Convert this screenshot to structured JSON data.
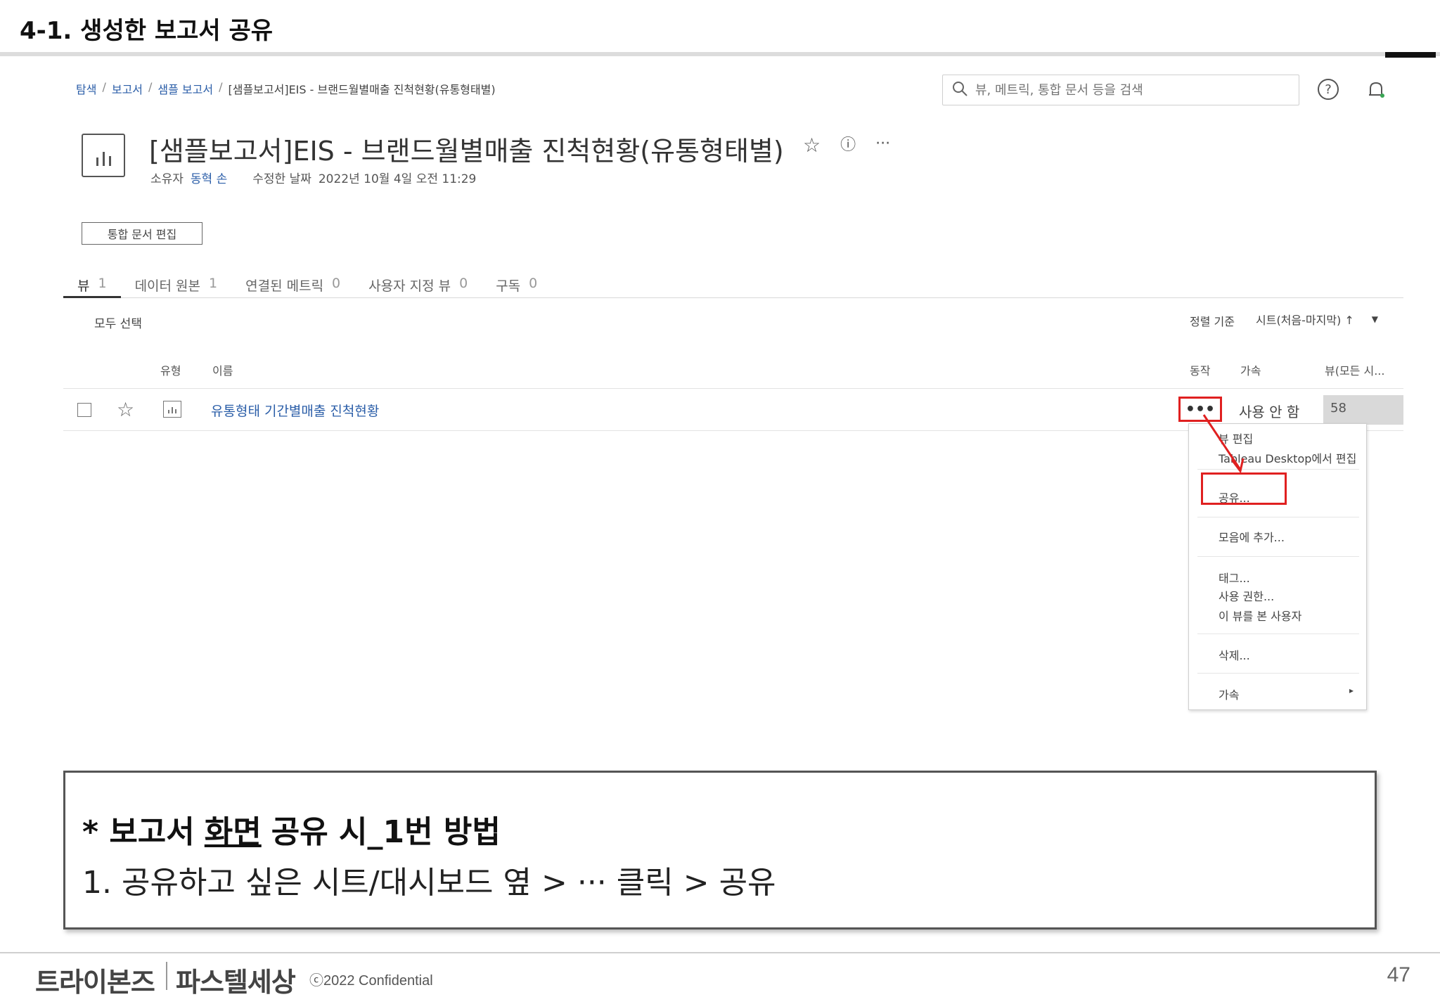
{
  "slide": {
    "title": "4-1. 생성한 보고서 공유",
    "page_number": "47",
    "copyright": "ⓒ2022 Confidential",
    "logo_left": "트라이본즈",
    "logo_right": "파스텔세상"
  },
  "breadcrumb": {
    "items": [
      "탐색",
      "보고서",
      "샘플 보고서",
      "[샘플보고서]EIS - 브랜드월별매출 진척현황(유통형태별)"
    ],
    "separator": "/"
  },
  "search": {
    "placeholder": "뷰, 메트릭, 통합 문서 등을 검색"
  },
  "icons": {
    "search": "search-icon",
    "help": "help-icon",
    "bell": "notification-bell-icon",
    "star": "star-icon",
    "info": "info-icon",
    "more": "more-icon"
  },
  "report": {
    "title": "[샘플보고서]EIS - 브랜드월별매출 진척현황(유통형태별)",
    "owner_label": "소유자",
    "owner": "동혁 손",
    "modified_label": "수정한 날짜",
    "modified": "2022년 10월 4일 오전 11:29",
    "edit_button": "통합 문서 편집"
  },
  "tabs": [
    {
      "label": "뷰",
      "count": "1",
      "active": true
    },
    {
      "label": "데이터 원본",
      "count": "1",
      "active": false
    },
    {
      "label": "연결된 메트릭",
      "count": "0",
      "active": false
    },
    {
      "label": "사용자 지정 뷰",
      "count": "0",
      "active": false
    },
    {
      "label": "구독",
      "count": "0",
      "active": false
    }
  ],
  "list": {
    "select_all": "모두 선택",
    "sort_label": "정렬 기준",
    "sort_value": "시트(처음-마지막) ↑",
    "columns": {
      "type": "유형",
      "name": "이름",
      "action": "동작",
      "certified": "가속",
      "views": "뷰(모든 시..."
    },
    "rows": [
      {
        "name": "유통형태 기간별매출 진척현황",
        "action": "•••",
        "certified": "사용 안 함",
        "views": "58"
      }
    ]
  },
  "menu": {
    "items": [
      "뷰 편집",
      "Tableau Desktop에서 편집",
      "공유...",
      "모음에 추가...",
      "태그...",
      "사용 권한...",
      "이 뷰를 본 사용자",
      "삭제...",
      "가속"
    ],
    "submenu_arrow": "▸"
  },
  "callout": {
    "heading_prefix": "* 보고서",
    "heading_underlined": "화면",
    "heading_suffix": "공유 시_1번 방법",
    "step": "1.  공유하고 싶은 시트/대시보드 옆 > ··· 클릭 > 공유"
  },
  "colors": {
    "highlight": "#e02020",
    "link": "#2b5ea8"
  }
}
